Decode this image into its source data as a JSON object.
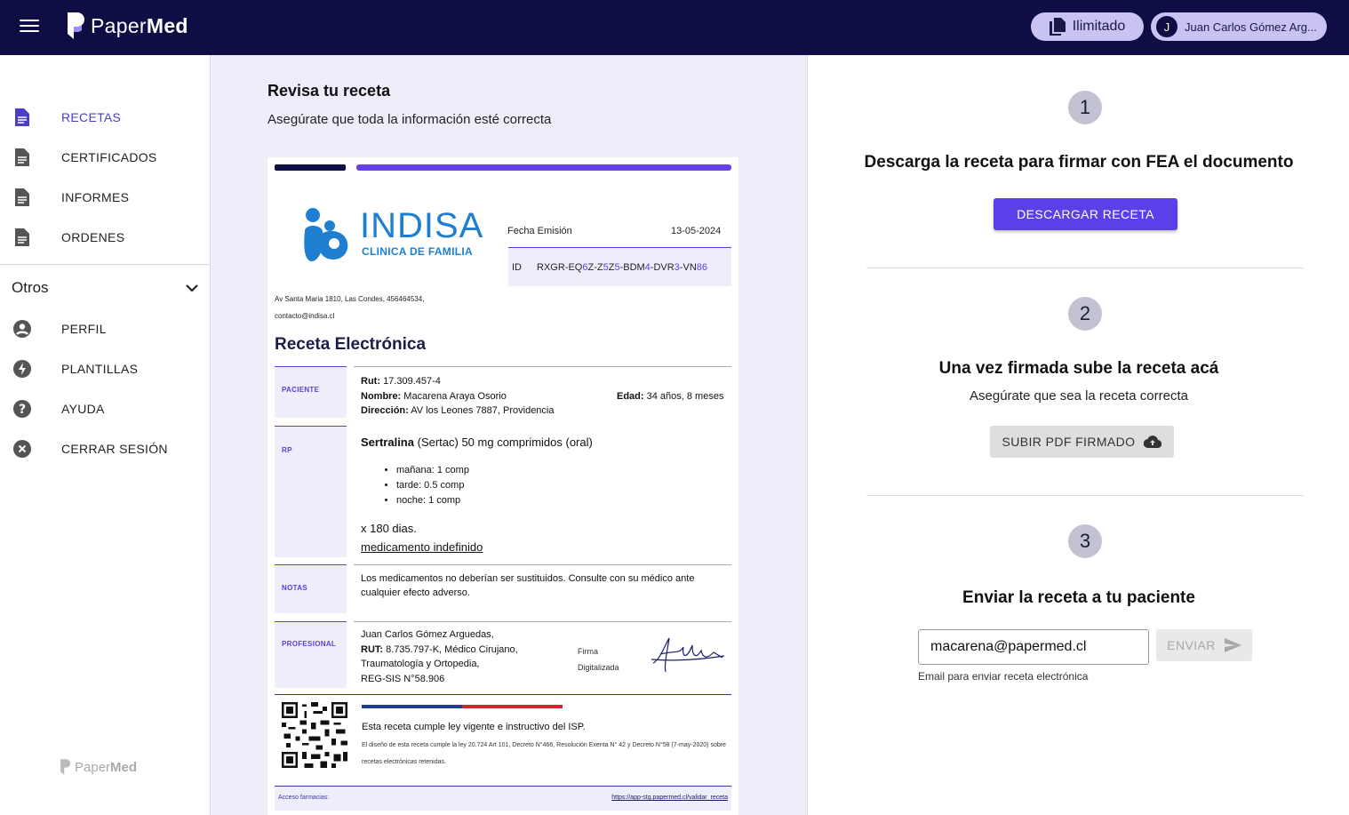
{
  "brand": {
    "name_light": "Paper",
    "name_bold": "Med"
  },
  "header": {
    "plan_label": "Ilimitado",
    "user_initial": "J",
    "user_name": "Juan Carlos Gómez Arg..."
  },
  "sidebar": {
    "items": [
      {
        "label": "RECETAS",
        "icon": "document-icon"
      },
      {
        "label": "CERTIFICADOS",
        "icon": "document-icon"
      },
      {
        "label": "INFORMES",
        "icon": "document-icon"
      },
      {
        "label": "ORDENES",
        "icon": "document-icon"
      }
    ],
    "group_label": "Otros",
    "other_items": [
      {
        "label": "PERFIL",
        "icon": "account-icon"
      },
      {
        "label": "PLANTILLAS",
        "icon": "bolt-icon"
      },
      {
        "label": "AYUDA",
        "icon": "help-icon"
      },
      {
        "label": "CERRAR SESIÓN",
        "icon": "cancel-icon"
      }
    ],
    "footer_logo_light": "Paper",
    "footer_logo_bold": "Med"
  },
  "review": {
    "title": "Revisa tu receta",
    "subtitle": "Asegúrate que toda la información esté correcta"
  },
  "prescription": {
    "clinic_name": "INDISA",
    "clinic_tagline": "CLINICA DE FAMILIA",
    "address": "Av Santa Maria 1810, Las Condes, 456464534,",
    "email": "contacto@indisa.cl",
    "fecha_label": "Fecha Emisión",
    "fecha_value": "13-05-2024",
    "id_label": "ID",
    "id_parts": [
      "RXGR-EQ",
      "6",
      "Z-Z",
      "5",
      "Z",
      "5",
      "-BDM",
      "4",
      "-DVR",
      "3",
      "-VN",
      "86"
    ],
    "title": "Receta Electrónica",
    "paciente": {
      "section_label": "PACIENTE",
      "rut_label": "Rut:",
      "rut": "17.309.457-4",
      "nombre_label": "Nombre:",
      "nombre": "Macarena Araya Osorio",
      "edad_label": "Edad:",
      "edad": "34 años, 8 meses",
      "direccion_label": "Dirección:",
      "direccion": "AV los Leones 7887, Providencia"
    },
    "rp": {
      "section_label": "RP",
      "drug_name": "Sertralina",
      "drug_detail": "(Sertac) 50 mg comprimidos (oral)",
      "doses": [
        "mañana: 1 comp",
        "tarde: 0.5 comp",
        "noche: 1 comp"
      ],
      "duration": "x 180 dias.",
      "indefinite": "medicamento indefinido"
    },
    "notas": {
      "section_label": "NOTAS",
      "text": "Los medicamentos no deberían ser sustituidos. Consulte con su médico ante cualquier efecto adverso."
    },
    "profesional": {
      "section_label": "PROFESIONAL",
      "name": "Juan Carlos Gómez Arguedas,",
      "rut_label": "RUT:",
      "rut": "8.735.797-K, Médico Cirujano,",
      "specialty": "Traumatología y Ortopedia,",
      "reg": "REG-SIS N°58.906",
      "firma_label_1": "Firma",
      "firma_label_2": "Digitalizada"
    },
    "footer": {
      "law_title": "Esta receta cumple ley vigente e instructivo del ISP.",
      "law_detail": "El diseño de esta receta cumple la ley 20.724 Art 101, Decreto N°466, Resolución Exenta N° 42 y Decreto N°58 (7-may-2020) sobre recetas electrónicas retenidas.",
      "pharmacy_label": "Acceso farmacias:",
      "pharmacy_link": "https://app-stg.papermed.cl/validar_receta"
    }
  },
  "steps": [
    {
      "number": "1",
      "title": "Descarga la receta para firmar con FEA el documento",
      "button": "DESCARGAR RECETA"
    },
    {
      "number": "2",
      "title": "Una vez firmada sube la receta acá",
      "subtitle": "Asegúrate que sea la receta correcta",
      "button": "SUBIR PDF FIRMADO"
    },
    {
      "number": "3",
      "title": "Enviar la receta a tu paciente",
      "email_value": "macarena@papermed.cl",
      "button": "ENVIAR",
      "helper": "Email para enviar receta electrónica"
    }
  ],
  "colors": {
    "navbar": "#0e0e45",
    "accent": "#5b3fe8",
    "pill": "#c9c3f3",
    "panel_bg": "#eeeefa"
  }
}
